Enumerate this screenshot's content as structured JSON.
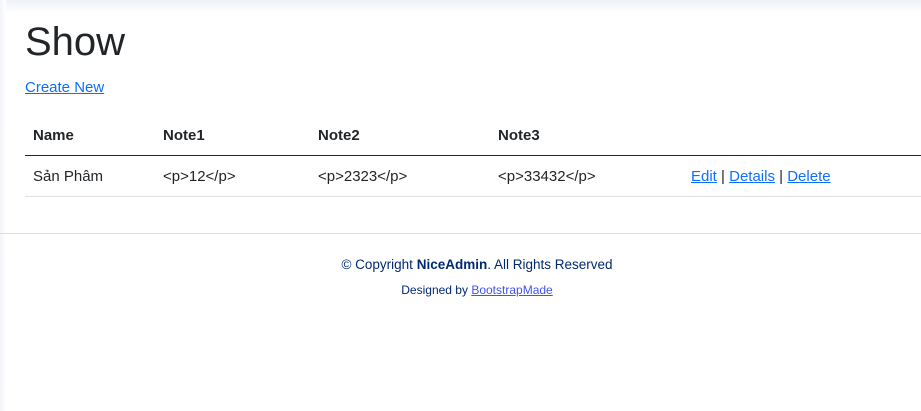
{
  "page": {
    "title": "Show",
    "create_link": "Create New"
  },
  "table": {
    "headers": [
      "Name",
      "Note1",
      "Note2",
      "Note3",
      ""
    ],
    "rows": [
      {
        "name": "Sản Phâm",
        "note1": "<p>12</p>",
        "note2": "<p>2323</p>",
        "note3": "<p>33432</p>",
        "actions": {
          "edit": "Edit",
          "details": "Details",
          "delete": "Delete",
          "separator": "|"
        }
      }
    ]
  },
  "footer": {
    "copyright_prefix": "© Copyright",
    "brand": "NiceAdmin",
    "copyright_suffix": ". All Rights Reserved",
    "designed_by": "Designed by",
    "designer_link": "BootstrapMade"
  },
  "colors": {
    "link": "#0d6efd",
    "footer_text": "#012970",
    "footer_link": "#4154f1"
  }
}
